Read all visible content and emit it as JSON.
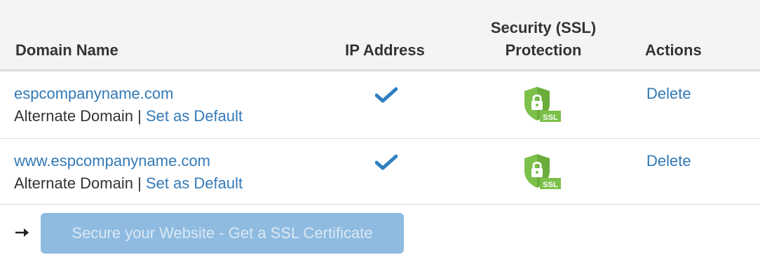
{
  "header": {
    "domain_name": "Domain Name",
    "ip_address": "IP Address",
    "ssl_line1": "Security (SSL)",
    "ssl_line2": "Protection",
    "actions": "Actions"
  },
  "rows": [
    {
      "domain": "espcompanyname.com",
      "type_label": "Alternate Domain",
      "separator": "|",
      "set_default_label": "Set as Default",
      "ip_icon": "checkmark-icon",
      "ssl_icon": "ssl-shield-icon",
      "delete_label": "Delete"
    },
    {
      "domain": "www.espcompanyname.com",
      "type_label": "Alternate Domain",
      "separator": "|",
      "set_default_label": "Set as Default",
      "ip_icon": "checkmark-icon",
      "ssl_icon": "ssl-shield-icon",
      "delete_label": "Delete"
    }
  ],
  "ssl_badge_text": "SSL",
  "footer": {
    "arrow_icon": "right-arrow-icon",
    "button_label": "Secure your Website - Get a SSL Certificate"
  },
  "colors": {
    "link": "#337ab7",
    "check": "#2f7fc1",
    "ssl_green": "#7cc04a",
    "button_disabled": "#8fbbe0"
  }
}
